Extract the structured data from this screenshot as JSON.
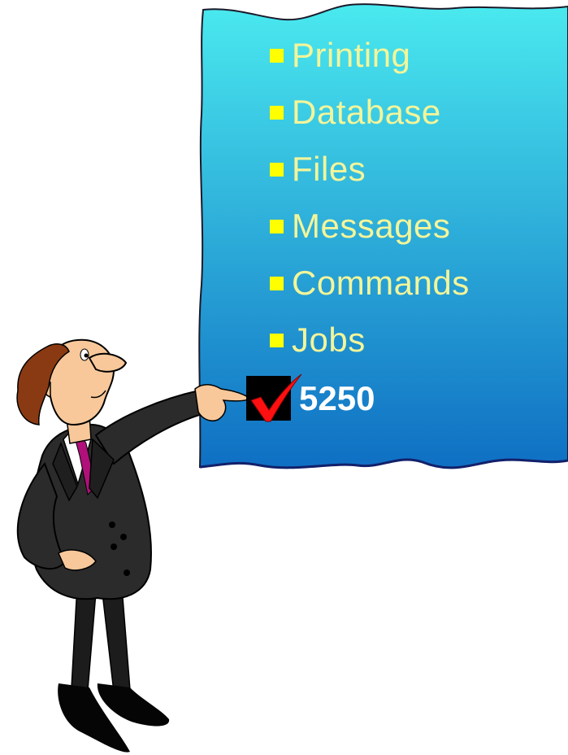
{
  "colors": {
    "board_top": "#4ae9ef",
    "board_bottom": "#0f6fc3",
    "item_text": "#f3f59a",
    "bullet": "#ffff00",
    "checked_text": "#ffffff",
    "check_mark": "#ff1010",
    "suit": "#2b2b2b",
    "skin": "#f8c89a",
    "hair": "#8a3a12",
    "tie": "#b0107a"
  },
  "board": {
    "items": [
      {
        "label": "Printing"
      },
      {
        "label": "Database"
      },
      {
        "label": "Files"
      },
      {
        "label": "Messages"
      },
      {
        "label": "Commands"
      },
      {
        "label": "Jobs"
      }
    ],
    "checked_item": {
      "label": "5250",
      "icon": "checkmark-icon"
    }
  },
  "figure": {
    "icon": "presenter-man-icon"
  }
}
